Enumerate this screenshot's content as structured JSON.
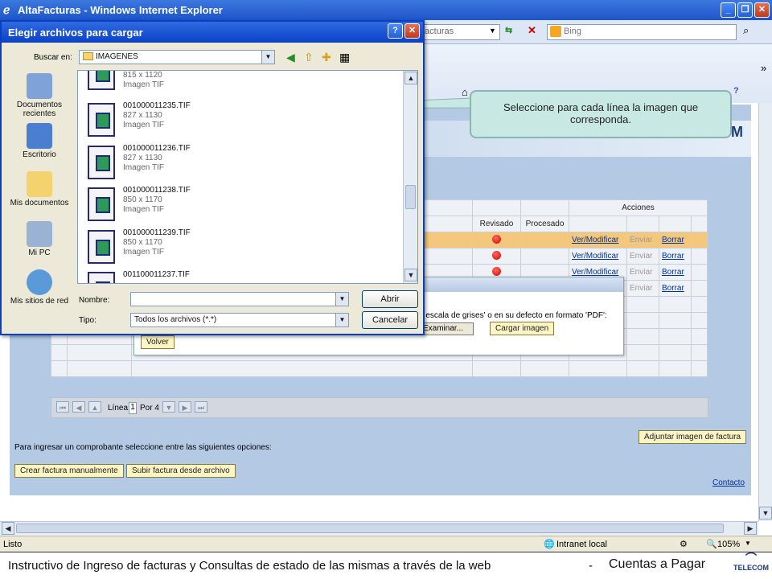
{
  "ie": {
    "title": "AltaFacturas - Windows Internet Explorer",
    "address_fragment": "facturas",
    "search_placeholder": "Bing",
    "status": "Listo",
    "zone": "Intranet local",
    "zoom": "105%"
  },
  "dialog": {
    "title": "Elegir archivos para cargar",
    "lookin_label": "Buscar en:",
    "folder": "IMAGENES",
    "places": [
      "Documentos recientes",
      "Escritorio",
      "Mis documentos",
      "Mi PC",
      "Mis sitios de red"
    ],
    "files": [
      {
        "name": "",
        "dims": "815 x 1120",
        "type": "Imagen TIF"
      },
      {
        "name": "001000011235.TIF",
        "dims": "827 x 1130",
        "type": "Imagen TIF"
      },
      {
        "name": "001000011236.TIF",
        "dims": "827 x 1130",
        "type": "Imagen TIF"
      },
      {
        "name": "001000011238.TIF",
        "dims": "850 x 1170",
        "type": "Imagen TIF"
      },
      {
        "name": "001000011239.TIF",
        "dims": "850 x 1170",
        "type": "Imagen TIF"
      },
      {
        "name": "001100011237.TIF",
        "dims": "",
        "type": ""
      }
    ],
    "name_label": "Nombre:",
    "name_value": "",
    "type_label": "Tipo:",
    "type_value": "Todos los archivos (*.*)",
    "open_button": "Abrir",
    "cancel_button": "Cancelar"
  },
  "callout": "Seleccione para cada línea la imagen que corresponda.",
  "grid": {
    "acciones": "Acciones",
    "revisado": "Revisado",
    "procesado": "Procesado",
    "rows": [
      {
        "ver": "Ver/Modificar",
        "enviar": "Enviar",
        "borrar": "Borrar"
      },
      {
        "ver": "Ver/Modificar",
        "enviar": "Enviar",
        "borrar": "Borrar"
      },
      {
        "ver": "Ver/Modificar",
        "enviar": "Enviar",
        "borrar": "Borrar"
      },
      {
        "ver": "",
        "enviar": "Enviar",
        "borrar": "Borrar"
      }
    ],
    "linea_label": "Línea",
    "linea_value": "1",
    "por": "Por 4"
  },
  "upload": {
    "text": "n escala de grises' o en su defecto en formato 'PDF':",
    "examinar": "Examinar...",
    "cargar": "Cargar imagen",
    "volver": "Volver"
  },
  "adjuntar": "Adjuntar imagen de factura",
  "options_text": "Para ingresar un comprobante seleccione entre las siguientes opciones:",
  "crear": "Crear factura manualmente",
  "subir": "Subir factura desde archivo",
  "contacto": "Contacto",
  "footer": {
    "text": "Instructivo de Ingreso de facturas y Consultas de estado de las mismas a través de la web",
    "sep": "-",
    "section": "Cuentas a Pagar",
    "logo": "TELECOM"
  }
}
